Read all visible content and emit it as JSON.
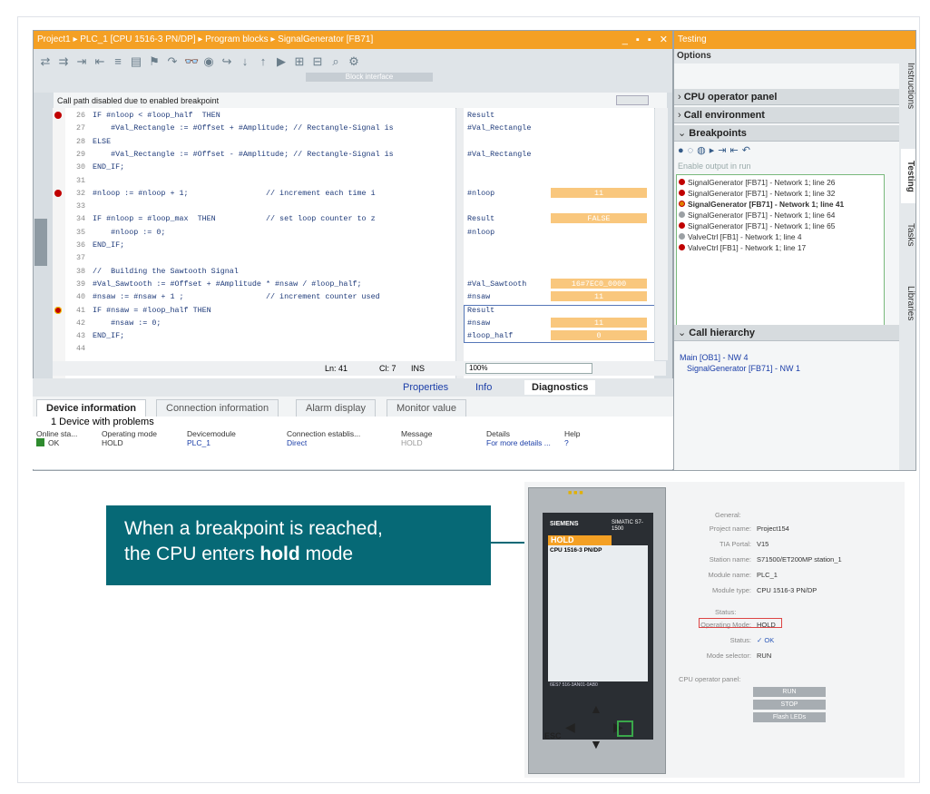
{
  "editor": {
    "title": "Project1 ▸ PLC_1 [CPU 1516-3 PN/DP] ▸ Program blocks ▸ SignalGenerator [FB71]",
    "window_controls": "_ ▪ ▪ ✕",
    "block_interface": "Block interface",
    "notice": "Call path disabled due to enabled breakpoint",
    "code_lines": [
      {
        "n": "26",
        "t": "IF #nloop < #loop_half  THEN",
        "bp": "red"
      },
      {
        "n": "27",
        "t": "    #Val_Rectangle := #Offset + #Amplitude; // Rectangle-Signal is"
      },
      {
        "n": "28",
        "t": "ELSE"
      },
      {
        "n": "29",
        "t": "    #Val_Rectangle := #Offset - #Amplitude; // Rectangle-Signal is"
      },
      {
        "n": "30",
        "t": "END_IF;"
      },
      {
        "n": "31",
        "t": ""
      },
      {
        "n": "32",
        "t": "#nloop := #nloop + 1;                 // increment each time i",
        "bp": "red"
      },
      {
        "n": "33",
        "t": ""
      },
      {
        "n": "34",
        "t": "IF #nloop = #loop_max  THEN           // set loop counter to z"
      },
      {
        "n": "35",
        "t": "    #nloop := 0;"
      },
      {
        "n": "36",
        "t": "END_IF;"
      },
      {
        "n": "37",
        "t": ""
      },
      {
        "n": "38",
        "t": "//  Building the Sawtooth Signal"
      },
      {
        "n": "39",
        "t": "#Val_Sawtooth := #Offset + #Amplitude * #nsaw / #loop_half;"
      },
      {
        "n": "40",
        "t": "#nsaw := #nsaw + 1 ;                  // increment counter used"
      },
      {
        "n": "41",
        "t": "IF #nsaw = #loop_half THEN",
        "bp": "cur"
      },
      {
        "n": "42",
        "t": "    #nsaw := 0;"
      },
      {
        "n": "43",
        "t": "END_IF;"
      },
      {
        "n": "44",
        "t": ""
      }
    ],
    "monitor": [
      {
        "row": 0,
        "var": "Result",
        "val": ""
      },
      {
        "row": 1,
        "var": "#Val_Rectangle",
        "val": ""
      },
      {
        "row": 3,
        "var": "#Val_Rectangle",
        "val": ""
      },
      {
        "row": 6,
        "var": "#nloop",
        "val": "11"
      },
      {
        "row": 8,
        "var": "Result",
        "val": "FALSE"
      },
      {
        "row": 9,
        "var": "#nloop",
        "val": ""
      },
      {
        "row": 13,
        "var": "#Val_Sawtooth",
        "val": "16#7EC0_0000"
      },
      {
        "row": 14,
        "var": "#nsaw",
        "val": "11"
      },
      {
        "row": 15,
        "var": "Result",
        "val": ""
      },
      {
        "row": 16,
        "var": "#nsaw",
        "val": "11"
      },
      {
        "row": 17,
        "var": "#loop_half",
        "val": "0"
      }
    ],
    "status": {
      "ln": "Ln: 41",
      "cl": "Cl: 7",
      "ins": "INS",
      "zoom": "100%"
    },
    "inspector_tabs": {
      "properties": "Properties",
      "info": "Info",
      "diagnostics": "Diagnostics"
    },
    "diag_tabs": [
      "Device information",
      "Connection information",
      "Alarm display",
      "Monitor value"
    ],
    "device_count": "1 Device with problems",
    "table_headers": [
      "Online sta...",
      "Operating mode",
      "Devicemodule",
      "Connection establis...",
      "Message",
      "Details",
      "Help"
    ],
    "table_row": [
      "OK",
      "HOLD",
      "PLC_1",
      "Direct",
      "HOLD",
      "For more details ...",
      "?"
    ]
  },
  "testing": {
    "title": "Testing",
    "options": "Options",
    "cpu_panel": "CPU operator panel",
    "call_env": "Call environment",
    "breakpoints": "Breakpoints",
    "enable_output": "Enable output in run",
    "bp_items": [
      {
        "t": "SignalGenerator [FB71] - Network 1; line 26",
        "c": "red"
      },
      {
        "t": "SignalGenerator [FB71] - Network 1; line 32",
        "c": "red"
      },
      {
        "t": "SignalGenerator [FB71] - Network 1; line 41",
        "c": "cur"
      },
      {
        "t": "SignalGenerator [FB71] - Network 1; line 64",
        "c": "grey"
      },
      {
        "t": "SignalGenerator [FB71] - Network 1; line 65",
        "c": "red"
      },
      {
        "t": "ValveCtrl [FB1] - Network 1; line 4",
        "c": "grey"
      },
      {
        "t": "ValveCtrl [FB1] - Network 1; line 17",
        "c": "red"
      }
    ],
    "call_hierarchy": "Call hierarchy",
    "call_lines": [
      "Main [OB1] - NW 4",
      "SignalGenerator [FB71] - NW 1"
    ],
    "side_tabs": [
      "Instructions",
      "Testing",
      "Tasks",
      "Libraries"
    ]
  },
  "callout": {
    "line1": "When a breakpoint is reached,",
    "line2_pre": "the CPU enters ",
    "line2_bold": "hold",
    "line2_post": " mode"
  },
  "cpu": {
    "brand": "SIEMENS",
    "model": "SIMATIC S7-1500",
    "mode": "HOLD",
    "cpu_name": "CPU 1516-3 PN/DP",
    "order_no": "6ES7 516-3AN01-0AB0",
    "esc": "ESC"
  },
  "cpu_info": {
    "general": "General:",
    "rows": [
      {
        "k": "Project name:",
        "v": "Project154"
      },
      {
        "k": "TIA Portal:",
        "v": "V15"
      },
      {
        "k": "Station name:",
        "v": "S71500/ET200MP station_1"
      },
      {
        "k": "Module name:",
        "v": "PLC_1"
      },
      {
        "k": "Module type:",
        "v": "CPU 1516-3 PN/DP"
      }
    ],
    "status_h": "Status:",
    "status_rows": [
      {
        "k": "Operating Mode:",
        "v": "HOLD"
      },
      {
        "k": "Status:",
        "v": "✓ OK"
      },
      {
        "k": "Mode selector:",
        "v": "RUN"
      }
    ],
    "panel_h": "CPU operator panel:",
    "buttons": [
      "RUN",
      "STOP",
      "Flash LEDs"
    ]
  }
}
